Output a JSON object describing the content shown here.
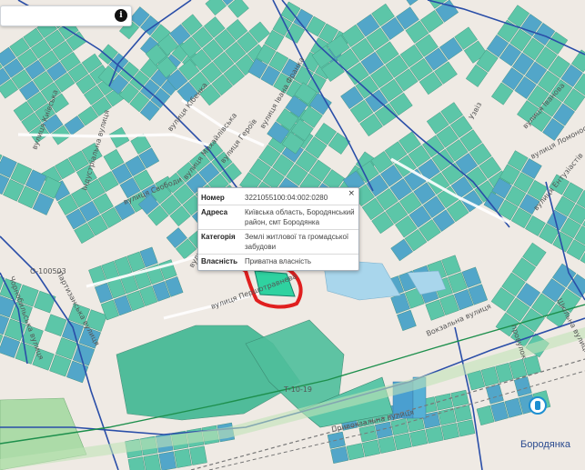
{
  "search": {
    "placeholder": "",
    "info_icon": "i"
  },
  "popup": {
    "close": "×",
    "rows": [
      {
        "key": "Номер",
        "value": "3221055100:04:002:0280"
      },
      {
        "key": "Адреса",
        "value": "Київська область, Бородянський район, смт Бородянка"
      },
      {
        "key": "Категорія",
        "value": "Землі житлової та громадської забудови"
      },
      {
        "key": "Власність",
        "value": "Приватна власність"
      }
    ]
  },
  "labels": {
    "street_kibenka": "вулиця Кібенка",
    "street_mykhailivska": "вулиця Михайлівська",
    "street_heroiv": "вулиця Героїв",
    "street_ivana_franka": "вулиця Івана Франка",
    "street_industrialna": "Індустріальна вулиця",
    "street_kyivska": "вулиця Київська",
    "street_svobody": "вулиця Свободи",
    "street_druzhby": "вулиця Дружби",
    "street_pershotravneva": "вулиця Першотравнева",
    "street_chornobylska": "Чорнобильська вулиця",
    "street_partyzanska": "Партизанська вулиця",
    "street_vokzalna": "Вокзальна вулиця",
    "street_pryvokzalna": "Привокзальна вулиця",
    "street_lomonosova": "вулиця Ломоносова",
    "street_entuziastiv": "вулиця Ентузіастів",
    "street_shkilna": "Шкільна вулиця",
    "street_ivanova": "вулиця Іванова",
    "street_uzvoz": "Узвіз",
    "lane_ivana": "провулок",
    "road_o": "О-100503",
    "road_t": "Т-10-19",
    "place_borodianka": "Бородянка"
  },
  "colors": {
    "parcel_fill": "#5cc6a8",
    "parcel_alt": "#52a6c9",
    "parcel_stroke": "#3f8f79",
    "road_blue": "#2a4ea8",
    "rail": "#777",
    "highlight": "#e01f1f",
    "selected": "#2fd2a0"
  }
}
